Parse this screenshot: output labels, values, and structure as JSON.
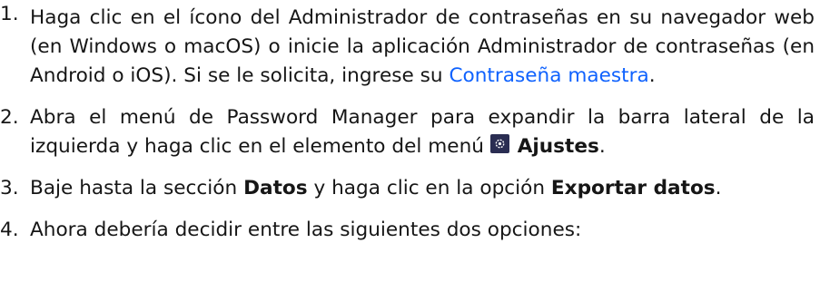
{
  "steps": [
    {
      "number": "1.",
      "text_before": "Haga clic en el ícono del Administrador de contraseñas en su navegador web (en Windows o macOS) o inicie la aplicación Administrador de contraseñas (en Android o iOS). Si se le solicita, ingrese su ",
      "link": "Contraseña maestra",
      "text_after": "."
    },
    {
      "number": "2.",
      "text_before": "Abra el menú de Password Manager para expandir la barra lateral de la izquierda y haga clic en el elemento del menú ",
      "icon": "settings-gear-icon",
      "bold": "Ajustes",
      "text_after": "."
    },
    {
      "number": "3.",
      "text_before": "Baje hasta la sección ",
      "bold1": "Datos",
      "text_mid": " y haga clic en la opción ",
      "bold2": "Exportar datos",
      "text_after": "."
    },
    {
      "number": "4.",
      "text": "Ahora debería decidir entre las siguientes dos opciones:"
    }
  ],
  "colors": {
    "link": "#0f62fe",
    "text": "#161616",
    "icon_bg": "#2a2d52"
  }
}
